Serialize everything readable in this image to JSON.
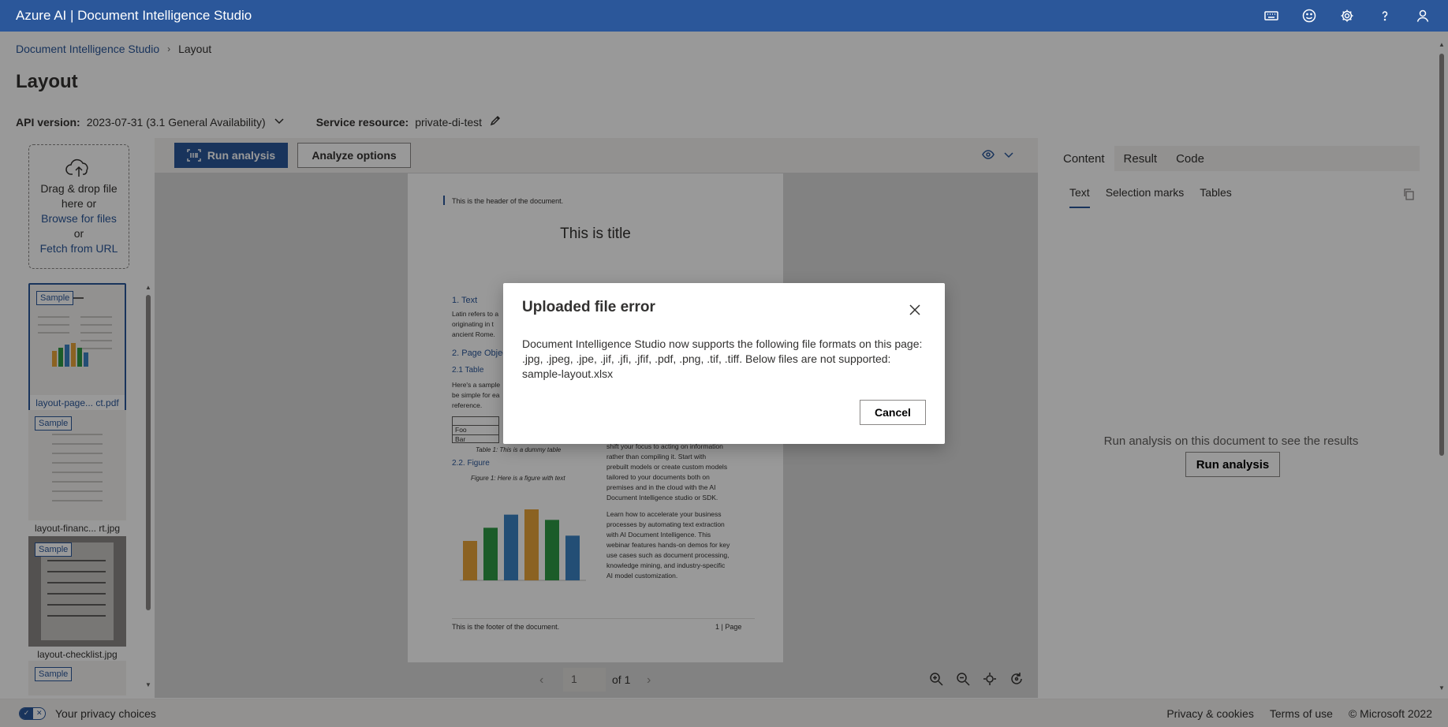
{
  "app": {
    "title": "Azure AI | Document Intelligence Studio",
    "top_icons": [
      "keyboard-icon",
      "feedback-smiley-icon",
      "settings-gear-icon",
      "help-icon",
      "account-icon"
    ]
  },
  "breadcrumb": {
    "home": "Document Intelligence Studio",
    "current": "Layout"
  },
  "page": {
    "title": "Layout",
    "api_version_label": "API version:",
    "api_version_value": "2023-07-31 (3.1 General Availability)",
    "service_resource_label": "Service resource:",
    "service_resource_value": "private-di-test"
  },
  "upload": {
    "line1": "Drag & drop file here or",
    "browse": "Browse for files",
    "or": "or",
    "fetch": "Fetch from URL"
  },
  "files": [
    {
      "badge": "Sample",
      "name": "layout-page... ct.pdf",
      "selected": true
    },
    {
      "badge": "Sample",
      "name": "layout-financ... rt.jpg",
      "selected": false
    },
    {
      "badge": "Sample",
      "name": "layout-checklist.jpg",
      "selected": false
    },
    {
      "badge": "Sample",
      "name": "",
      "selected": false
    }
  ],
  "toolbar": {
    "run_analysis": "Run analysis",
    "analyze_options": "Analyze options"
  },
  "document": {
    "header": "This is the header of the document.",
    "title": "This is title",
    "sec1": "1. Text",
    "sec1_text": "Latin refers to a\noriginating in t\nancient Rome.",
    "sec2": "2. Page Objec",
    "sec21": "2.1 Table",
    "sec21_text": "Here's a sample\nbe simple for ea\nreference.",
    "table_rows": [
      "Foo",
      "Bar"
    ],
    "table_caption": "Table 1: This is a dummy table",
    "sec22": "2.2. Figure",
    "fig_caption": "Figure 1: Here is a figure with text",
    "right_col_1": "shift your focus to acting on information\nrather than compiling it. Start with\nprebuilt models or create custom models\ntailored to your documents both on\npremises and in the cloud with the AI\nDocument Intelligence studio or SDK.",
    "right_col_2": "Learn how to accelerate your business\nprocesses by automating text extraction\nwith AI Document Intelligence. This\nwebinar features hands-on demos for key\nuse cases such as document processing,\nknowledge mining, and industry-specific\nAI model customization.",
    "footer": "This is the footer of the document.",
    "page_label": "1 | Page",
    "bar_values": [
      300,
      400,
      500,
      540,
      460,
      340
    ],
    "bar_colors": [
      "#e8a33a",
      "#2e9a45",
      "#3b82c4",
      "#e8a33a",
      "#2e9a45",
      "#3b82c4"
    ]
  },
  "pager": {
    "current": "1",
    "of": "of 1"
  },
  "results": {
    "tabs": [
      "Content",
      "Result",
      "Code"
    ],
    "active_tab": "Content",
    "subtabs": [
      "Text",
      "Selection marks",
      "Tables"
    ],
    "active_subtab": "Text",
    "empty_message": "Run analysis on this document to see the results",
    "run_button": "Run analysis"
  },
  "footer": {
    "privacy": "Your privacy choices",
    "links": [
      "Privacy & cookies",
      "Terms of use",
      "© Microsoft 2022"
    ]
  },
  "dialog": {
    "title": "Uploaded file error",
    "body": "Document Intelligence Studio now supports the following file formats on this page: .jpg, .jpeg, .jpe, .jif, .jfi, .jfif, .pdf, .png, .tif, .tiff. Below files are not supported:",
    "file": "sample-layout.xlsx",
    "cancel": "Cancel"
  },
  "colors": {
    "brand": "#2b579a",
    "overlay": "rgba(0,0,0,0.4)"
  }
}
